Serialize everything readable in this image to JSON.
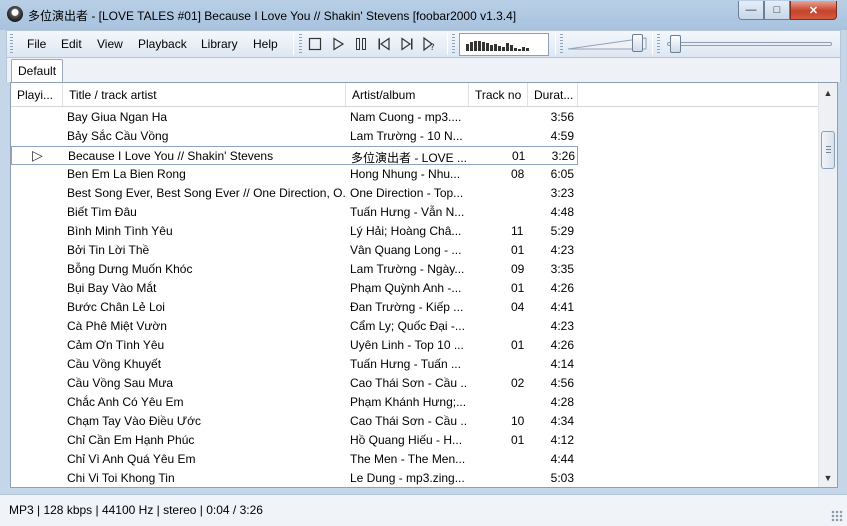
{
  "window": {
    "title": "多位演出者 - [LOVE TALES #01] Because I Love You // Shakin' Stevens   [foobar2000 v1.3.4]",
    "minimize_glyph": "—",
    "maximize_glyph": "□",
    "close_glyph": "✕"
  },
  "menu": {
    "items": [
      "File",
      "Edit",
      "View",
      "Playback",
      "Library",
      "Help"
    ]
  },
  "toolbar": {
    "buttons": [
      "stop-icon",
      "play-icon",
      "pause-icon",
      "previous-icon",
      "next-icon",
      "random-icon"
    ]
  },
  "visualizer": {
    "levels": [
      0.45,
      0.55,
      0.6,
      0.65,
      0.55,
      0.5,
      0.4,
      0.45,
      0.3,
      0.25,
      0.5,
      0.35,
      0.2,
      0.15,
      0.25,
      0.2
    ]
  },
  "volume": {
    "level": 0.9
  },
  "seek": {
    "position": 0.02
  },
  "tabs": [
    "Default"
  ],
  "playlist": {
    "columns": [
      "Playi...",
      "Title / track artist",
      "Artist/album",
      "Track no",
      "Durat..."
    ],
    "rows": [
      {
        "playing": "",
        "title": "Bay Giua Ngan Ha",
        "artist": "Nam Cuong - mp3....",
        "track": "",
        "duration": "3:56"
      },
      {
        "playing": "",
        "title": "Bảy Sắc Cầu Vồng",
        "artist": "Lam Trường - 10 N...",
        "track": "",
        "duration": "4:59"
      },
      {
        "playing": "▷",
        "title": "Because I Love You // Shakin' Stevens",
        "artist": "多位演出者 - LOVE ...",
        "track": "01",
        "duration": "3:26",
        "active": true
      },
      {
        "playing": "",
        "title": "Ben Em La Bien Rong",
        "artist": "Hong Nhung - Nhu...",
        "track": "08",
        "duration": "6:05"
      },
      {
        "playing": "",
        "title": "Best Song Ever, Best Song Ever // One Direction, O...",
        "artist": "One Direction - Top...",
        "track": "",
        "duration": "3:23"
      },
      {
        "playing": "",
        "title": "Biết Tìm Đâu",
        "artist": "Tuấn Hưng - Vẫn N...",
        "track": "",
        "duration": "4:48"
      },
      {
        "playing": "",
        "title": "Bình Minh Tình Yêu",
        "artist": "Lý Hải; Hoàng Châ...",
        "track": "11",
        "duration": "5:29"
      },
      {
        "playing": "",
        "title": "Bởi Tin Lời Thề",
        "artist": "Vân Quang Long - ...",
        "track": "01",
        "duration": "4:23"
      },
      {
        "playing": "",
        "title": "Bỗng Dưng Muốn Khóc",
        "artist": "Lam Trường - Ngày...",
        "track": "09",
        "duration": "3:35"
      },
      {
        "playing": "",
        "title": "Bụi Bay Vào Mắt",
        "artist": "Phạm Quỳnh Anh -...",
        "track": "01",
        "duration": "4:26"
      },
      {
        "playing": "",
        "title": "Bước Chân Lẻ Loi",
        "artist": "Đan Trường - Kiếp ...",
        "track": "04",
        "duration": "4:41"
      },
      {
        "playing": "",
        "title": "Cà Phê Miệt Vườn",
        "artist": "Cẩm Ly; Quốc Đại -...",
        "track": "",
        "duration": "4:23"
      },
      {
        "playing": "",
        "title": "Cảm Ơn Tình Yêu",
        "artist": "Uyên Linh - Top 10 ...",
        "track": "01",
        "duration": "4:26"
      },
      {
        "playing": "",
        "title": "Cầu Vồng Khuyết",
        "artist": "Tuấn Hưng - Tuấn ...",
        "track": "",
        "duration": "4:14"
      },
      {
        "playing": "",
        "title": "Cầu Vồng Sau Mưa",
        "artist": "Cao Thái Sơn - Cầu ...",
        "track": "02",
        "duration": "4:56"
      },
      {
        "playing": "",
        "title": "Chắc Anh Có Yêu Em",
        "artist": "Phạm Khánh Hưng;...",
        "track": "",
        "duration": "4:28"
      },
      {
        "playing": "",
        "title": "Chạm Tay Vào Điều Ước",
        "artist": "Cao Thái Sơn - Cầu ...",
        "track": "10",
        "duration": "4:34"
      },
      {
        "playing": "",
        "title": "Chỉ Cần Em Hạnh Phúc",
        "artist": "Hồ Quang Hiếu - H...",
        "track": "01",
        "duration": "4:12"
      },
      {
        "playing": "",
        "title": "Chỉ Vì Anh Quá Yêu Em",
        "artist": "The Men - The Men...",
        "track": "",
        "duration": "4:44"
      },
      {
        "playing": "",
        "title": "Chi Vi Toi Khong Tin",
        "artist": "Le Dung - mp3.zing...",
        "track": "",
        "duration": "5:03"
      }
    ]
  },
  "scrollbar": {
    "up_glyph": "▲",
    "down_glyph": "▼"
  },
  "status": {
    "text": "MP3 | 128 kbps | 44100 Hz | stereo | 0:04 / 3:26"
  }
}
